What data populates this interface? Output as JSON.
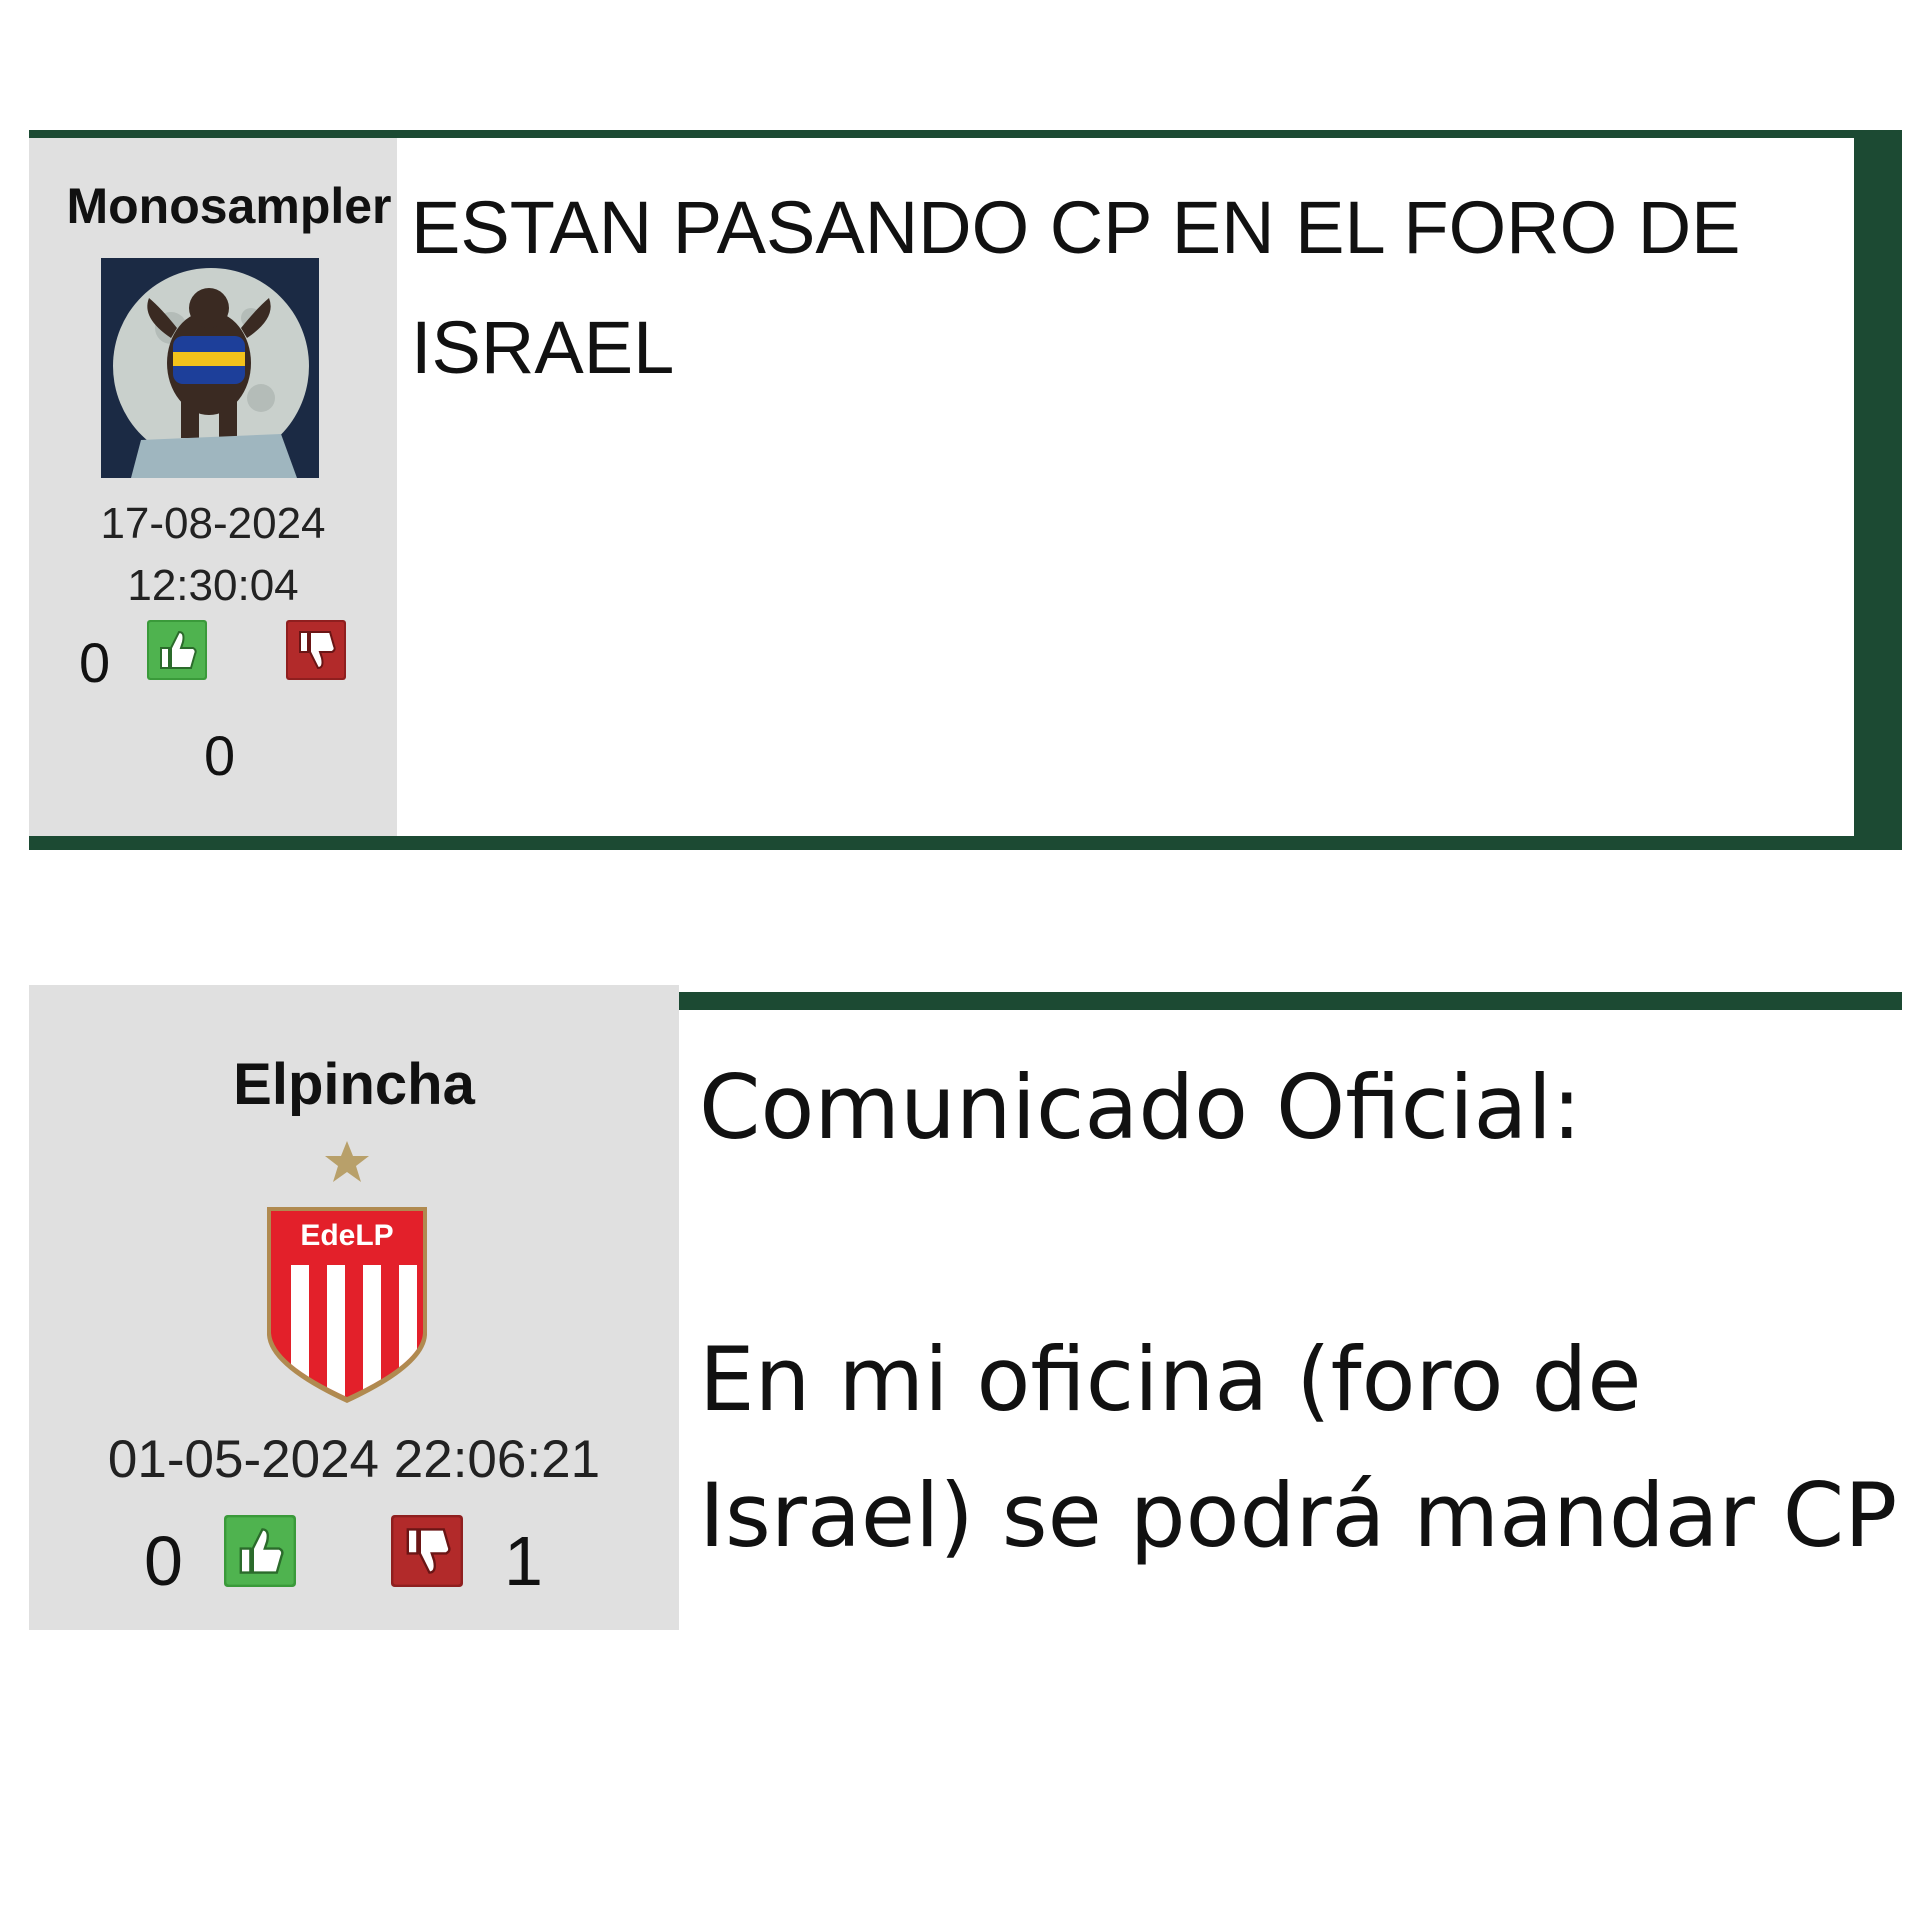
{
  "colors": {
    "frame_green": "#1c4a33",
    "userbox_gray": "#e0e0e0",
    "like_green": "#3a9a3a",
    "dislike_red": "#b22a2a",
    "estudiantes_red": "#e3202a",
    "star_gold": "#b8a06a"
  },
  "posts": [
    {
      "username": "Monosampler",
      "avatar_icon": "gorilla-boca-shirt-moon-avatar",
      "date": "17-08-2024",
      "time": "12:30:04",
      "likes": "0",
      "dislikes": "0",
      "body": "ESTAN PASANDO CP EN EL FORO DE ISRAEL"
    },
    {
      "username": "Elpincha",
      "avatar_icon": "estudiantes-shield-star-avatar",
      "avatar_text": "EdeLP",
      "datetime": "01-05-2024 22:06:21",
      "likes": "0",
      "dislikes": "1",
      "body_lines": [
        "Comunicado Oficial:",
        "En mi oficina (foro de Israel) se podrá mandar CP"
      ]
    }
  ]
}
